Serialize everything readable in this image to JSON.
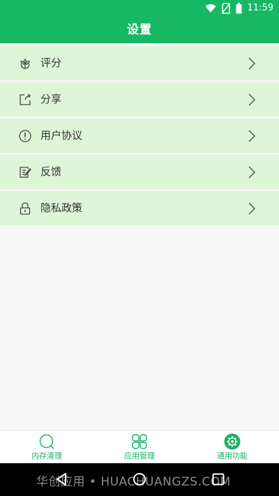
{
  "status_bar": {
    "time": "11:59",
    "icons": [
      "wifi-icon",
      "no-sim-icon",
      "battery-icon"
    ]
  },
  "header": {
    "title": "设置",
    "color": "#17b863"
  },
  "settings": {
    "row_color": "#dff5d8",
    "items": [
      {
        "label": "评分",
        "icon": "flower-icon"
      },
      {
        "label": "分享",
        "icon": "share-icon"
      },
      {
        "label": "用户协议",
        "icon": "info-icon"
      },
      {
        "label": "反馈",
        "icon": "edit-note-icon"
      },
      {
        "label": "隐私政策",
        "icon": "lock-icon"
      }
    ]
  },
  "bottom_nav": {
    "accent": "#19b263",
    "items": [
      {
        "label": "内存清理",
        "icon": "search-icon"
      },
      {
        "label": "应用管理",
        "icon": "clover-icon"
      },
      {
        "label": "通用功能",
        "icon": "gear-icon",
        "active": true
      }
    ]
  },
  "system_nav": {
    "watermark": "华创应用 • HUACHUANGZS.COM"
  }
}
